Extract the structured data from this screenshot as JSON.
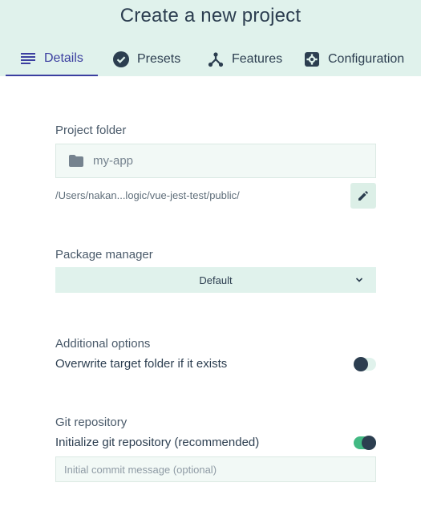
{
  "header": {
    "title": "Create a new project",
    "tabs": [
      {
        "label": "Details",
        "icon": "list-icon",
        "active": true
      },
      {
        "label": "Presets",
        "icon": "check-circle-icon",
        "active": false
      },
      {
        "label": "Features",
        "icon": "fork-icon",
        "active": false
      },
      {
        "label": "Configuration",
        "icon": "settings-gear-icon",
        "active": false
      }
    ]
  },
  "details": {
    "project_folder": {
      "label": "Project folder",
      "value": "my-app",
      "path": "/Users/nakan...logic/vue-jest-test/public/"
    },
    "package_manager": {
      "label": "Package manager",
      "selected": "Default"
    },
    "additional_options": {
      "label": "Additional options",
      "overwrite_label": "Overwrite target folder if it exists",
      "overwrite_enabled": false
    },
    "git": {
      "label": "Git repository",
      "init_label": "Initialize git repository (recommended)",
      "init_enabled": true,
      "commit_placeholder": "Initial commit message (optional)",
      "commit_value": ""
    }
  },
  "colors": {
    "accent": "#3b3fa0",
    "header_bg": "#e0f2ec",
    "toggle_on": "#42b983",
    "text": "#2c3e50"
  }
}
